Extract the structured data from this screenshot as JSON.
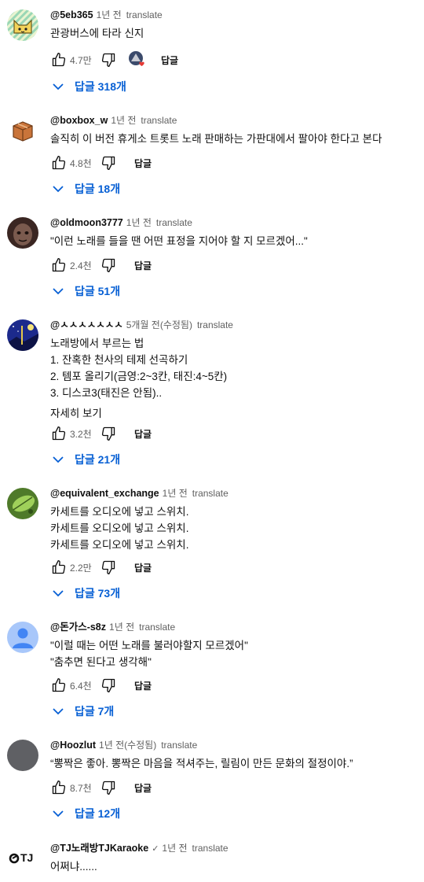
{
  "ui": {
    "translate": "translate",
    "reply": "답글",
    "more": "자세히 보기"
  },
  "comments": [
    {
      "author": "@5eb365",
      "time": "1년 전",
      "lines": [
        "관광버스에 타라 신지"
      ],
      "likes": "4.7만",
      "replies": "답글 318개"
    },
    {
      "author": "@boxbox_w",
      "time": "1년 전",
      "lines": [
        "솔직히 이 버전 휴게소 트롯트 노래 판매하는 가판대에서 팔아야 한다고 본다"
      ],
      "likes": "4.8천",
      "replies": "답글 18개"
    },
    {
      "author": "@oldmoon3777",
      "time": "1년 전",
      "lines": [
        "\"이런 노래를 들을 땐 어떤 표정을 지어야 할 지 모르겠어...\""
      ],
      "likes": "2.4천",
      "replies": "답글 51개"
    },
    {
      "author": "@ㅅㅅㅅㅅㅅㅅㅅ",
      "time": "5개월 전(수정됨)",
      "lines": [
        "노래방에서 부르는 법",
        "1. 잔혹한 천사의 테제 선곡하기",
        "2. 템포 올리기(금영:2~3칸, 태진:4~5칸)",
        "3. 디스코3(태진은 안됨).."
      ],
      "likes": "3.2천",
      "replies": "답글 21개"
    },
    {
      "author": "@equivalent_exchange",
      "time": "1년 전",
      "lines": [
        "카세트를 오디오에 넣고 스위치.",
        "카세트를 오디오에 넣고 스위치.",
        "카세트를 오디오에 넣고 스위치."
      ],
      "likes": "2.2만",
      "replies": "답글 73개"
    },
    {
      "author": "@돈가스-s8z",
      "time": "1년 전",
      "lines": [
        "\"이럴 때는 어떤 노래를 불러야할지 모르겠어\"",
        "\"춤추면 된다고 생각해\""
      ],
      "likes": "6.4천",
      "replies": "답글 7개"
    },
    {
      "author": "@Hoozlut",
      "time": "1년 전(수정됨)",
      "lines": [
        "“뽕짝은 좋아. 뽕짝은 마음을 적셔주는, 릴림이 만든 문화의 절정이야.”"
      ],
      "likes": "8.7천",
      "replies": "답글 12개"
    },
    {
      "author": "@TJ노래방TJKaraoke",
      "time": "1년 전",
      "lines": [
        "어쩌냐......"
      ],
      "logo": "TJ"
    }
  ]
}
